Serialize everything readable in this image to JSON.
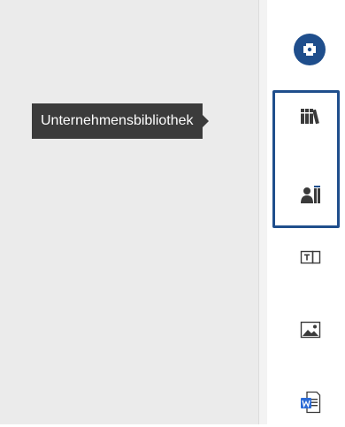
{
  "tooltip": {
    "text": "Unternehmensbibliothek"
  },
  "rail": {
    "items": [
      {
        "name": "add-content",
        "icon": "puzzle-plus-icon"
      },
      {
        "name": "company-library",
        "icon": "books-icon",
        "tooltip": "Unternehmensbibliothek"
      },
      {
        "name": "people-library",
        "icon": "person-books-icon"
      },
      {
        "name": "text-field",
        "icon": "text-box-icon"
      },
      {
        "name": "image",
        "icon": "image-icon"
      },
      {
        "name": "word-document",
        "icon": "word-doc-icon"
      }
    ]
  },
  "colors": {
    "accent": "#1f4e8c",
    "tooltip_bg": "#3b3b3b",
    "canvas_bg": "#ebebeb"
  }
}
